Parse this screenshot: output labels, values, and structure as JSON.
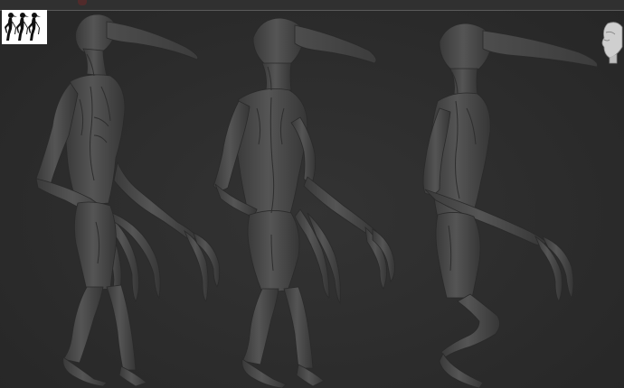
{
  "viewport": {
    "background": "#2b2b2b",
    "model_color": "#4a4a4a",
    "highlight_color": "#5c5c5c",
    "shadow_color": "#262626"
  },
  "views": [
    "front-three-quarter",
    "back-three-quarter",
    "side"
  ],
  "icons": {
    "thumbnail": "thumbnail-silhouettes-icon",
    "gizmo": "navigation-head-icon"
  }
}
